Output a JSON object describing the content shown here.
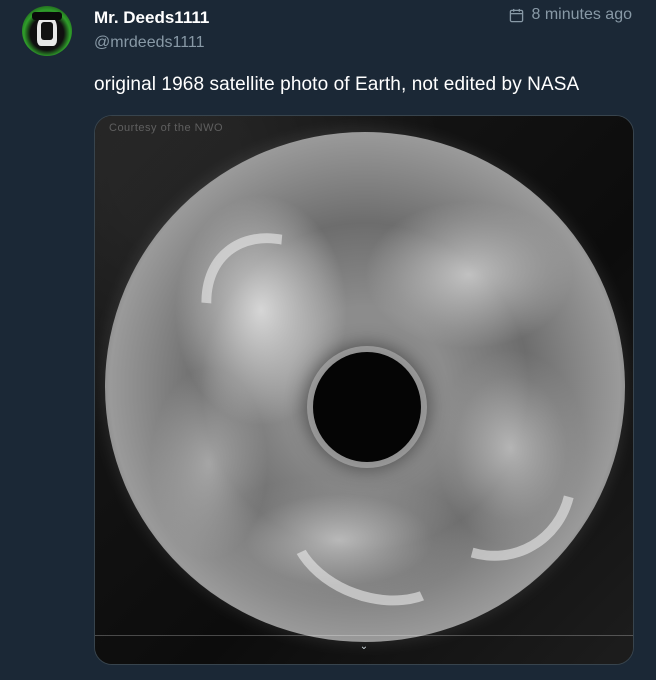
{
  "user": {
    "display_name": "Mr. Deeds1111",
    "handle": "@mrdeeds1111",
    "avatar_icon": "user-avatar-icon"
  },
  "timestamp": {
    "icon": "calendar-icon",
    "text": "8 minutes ago"
  },
  "tweet": {
    "text": "original 1968 satellite photo of Earth, not edited by NASA"
  },
  "media": {
    "watermark_text": "Courtesy of the NWO",
    "expand_icon": "chevron-down-icon"
  },
  "colors": {
    "background": "#1b2836",
    "primary_text": "#ffffff",
    "secondary_text": "#8899a6",
    "border": "#38444d"
  }
}
